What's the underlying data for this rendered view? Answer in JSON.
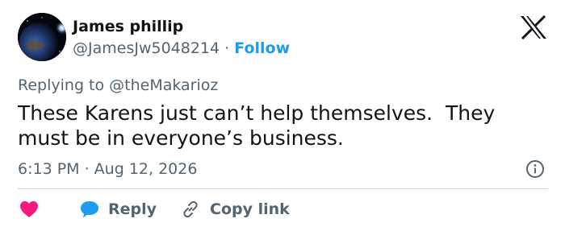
{
  "author": {
    "name": "James phillip",
    "handle": "@JamesJw5048214",
    "separator": "·",
    "follow_label": "Follow"
  },
  "reply_to": {
    "text": "Replying to @theMakarioz"
  },
  "tweet": {
    "text": "These Karens just can’t help themselves.  They must be in everyone’s business.",
    "timestamp": "6:13 PM · Aug 12, 2026"
  },
  "actions": {
    "reply_label": "Reply",
    "copy_link_label": "Copy link"
  },
  "icons": {
    "platform": "x-logo-icon",
    "info": "info-icon",
    "like": "heart-icon",
    "reply": "speech-bubble-icon",
    "copy": "link-icon"
  },
  "colors": {
    "accent": "#1d9bf0",
    "like": "#f91880",
    "text_primary": "#0f1419",
    "text_secondary": "#536471",
    "divider": "#cfd9de"
  }
}
